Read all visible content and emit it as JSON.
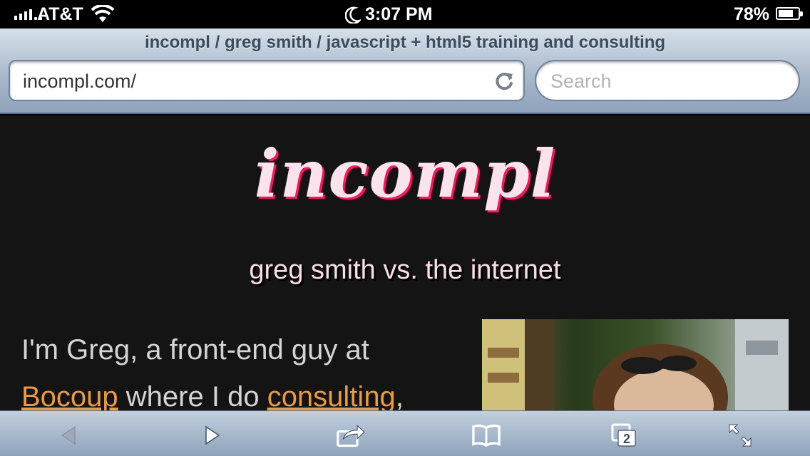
{
  "status_bar": {
    "carrier": "AT&T",
    "time": "3:07 PM",
    "battery_percent": "78%",
    "battery_level": 0.78,
    "icons": [
      "signal-icon",
      "wifi-icon",
      "do-not-disturb-moon-icon",
      "battery-icon"
    ]
  },
  "browser": {
    "page_title": "incompl / greg smith / javascript + html5 training and consulting",
    "url": "incompl.com/",
    "search_placeholder": "Search",
    "reload_icon": "reload-icon",
    "chrome_color": "#aab9cb"
  },
  "page": {
    "logo_text": "incompl",
    "tagline": "greg smith vs. the internet",
    "intro": {
      "line1": "I'm Greg, a front-end guy at",
      "link_bocoup": "Bocoup",
      "text_middle": " where I do ",
      "link_consulting": "consulting",
      "text_end": ","
    },
    "colors": {
      "background": "#141414",
      "logo": "#fbe3ee",
      "logo_shadow": "#e61f5f",
      "link": "#e59b4a",
      "text": "#d4d4d4"
    }
  },
  "toolbar": {
    "tab_count": "2",
    "icons": [
      "back-icon",
      "forward-icon",
      "share-icon",
      "bookmarks-icon",
      "tabs-icon",
      "fullscreen-icon"
    ]
  }
}
